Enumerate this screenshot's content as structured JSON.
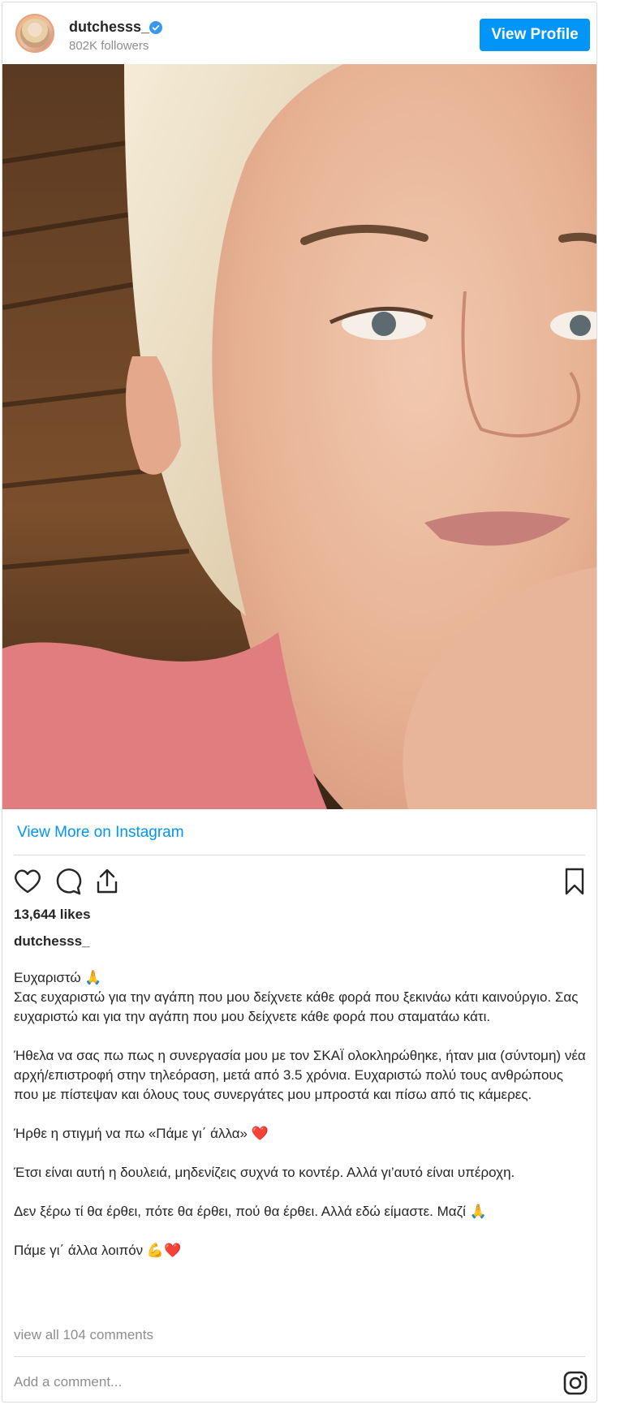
{
  "header": {
    "username": "dutchesss_",
    "followers": "802K followers",
    "view_profile_label": "View Profile"
  },
  "post": {
    "view_more_label": "View More on Instagram",
    "likes": "13,644 likes",
    "caption_username": "dutchesss_",
    "caption_paragraphs": [
      "Ευχαριστώ 🙏\nΣας ευχαριστώ για την αγάπη που μου δείχνετε κάθε φορά που ξεκινάω κάτι καινούργιο. Σας ευχαριστώ και για την αγάπη που μου δείχνετε κάθε φορά που σταματάω κάτι.",
      "Ήθελα να σας πω πως η συνεργασία μου με τον ΣΚΑΪ ολοκληρώθηκε, ήταν μια (σύντομη) νέα αρχή/επιστροφή στην τηλεόραση, μετά από 3.5 χρόνια. Ευχαριστώ πολύ τους ανθρώπους που με πίστεψαν και όλους τους συνεργάτες μου μπροστά και πίσω από τις κάμερες.",
      "Ήρθε η στιγμή να πω «Πάμε γι΄ άλλα» ❤️",
      "Έτσι είναι αυτή η δουλειά, μηδενίζεις συχνά το κοντέρ. Αλλά γι’αυτό είναι υπέροχη.",
      "Δεν ξέρω τί θα έρθει, πότε θα έρθει, πού θα έρθει. Αλλά εδώ είμαστε. Μαζί 🙏",
      "Πάμε γι΄ άλλα λοιπόν 💪❤️"
    ],
    "view_all_comments": "view all 104 comments",
    "comment_placeholder": "Add a comment..."
  },
  "icons": [
    "verified-badge-icon",
    "heart-icon",
    "comment-icon",
    "share-icon",
    "bookmark-icon",
    "instagram-icon"
  ],
  "colors": {
    "accent": "#0095f6",
    "text": "#262626",
    "muted": "#8e8e8e",
    "border": "#dbdbdb"
  }
}
